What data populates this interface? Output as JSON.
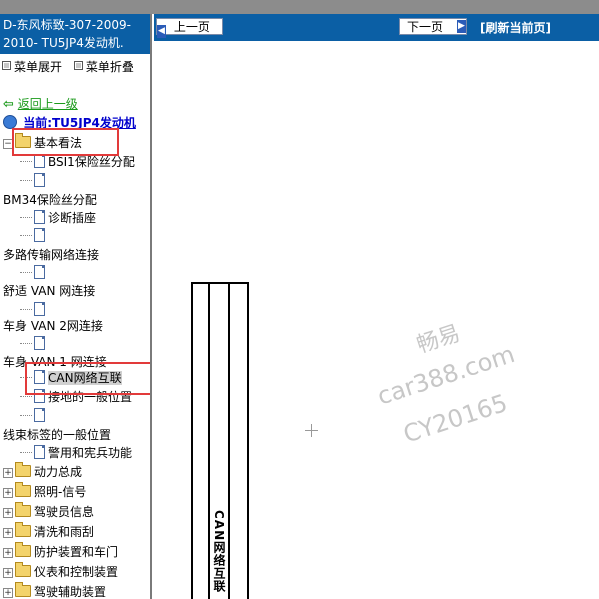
{
  "window": {
    "title_line1": "D-东风标致-307-2009-",
    "title_line2": "2010- TU5JP4发动机."
  },
  "menu": {
    "expand_label": "菜单展开",
    "collapse_label": "菜单折叠"
  },
  "navigation": {
    "back_label": "返回上一级",
    "current_label": "当前:TU5JP4发动机"
  },
  "tree": {
    "items": [
      {
        "label": "基本看法"
      },
      {
        "label": "BSI1保险丝分配"
      },
      {
        "label": ""
      },
      {
        "label": "BM34保险丝分配"
      },
      {
        "label": "诊断插座"
      },
      {
        "label": ""
      },
      {
        "label": "多路传输网络连接"
      },
      {
        "label": ""
      },
      {
        "label": "舒适 VAN 网连接"
      },
      {
        "label": ""
      },
      {
        "label": "车身 VAN 2网连接"
      },
      {
        "label": ""
      },
      {
        "label": "车身 VAN 1 网连接"
      },
      {
        "label": "CAN网络互联"
      },
      {
        "label": "接地的一般位置"
      },
      {
        "label": ""
      },
      {
        "label": "线束标签的一般位置"
      },
      {
        "label": "警用和宪兵功能"
      },
      {
        "label": "动力总成"
      },
      {
        "label": "照明-信号"
      },
      {
        "label": "驾驶员信息"
      },
      {
        "label": "清洗和雨刮"
      },
      {
        "label": "防护装置和车门"
      },
      {
        "label": "仪表和控制装置"
      },
      {
        "label": "驾驶辅助装置"
      }
    ]
  },
  "toolbar": {
    "prev_label": "上一页",
    "next_label": "下一页",
    "refresh_label": "[刷新当前页]"
  },
  "content": {
    "vertical_label": "CAN网络互联"
  },
  "watermark": {
    "line1": "畅易",
    "line2": "car388.com",
    "line3": "CY20165"
  },
  "colors": {
    "title_bar": "#0b5fa5",
    "highlight_box": "#e23a3a",
    "back_link": "#1a9a1a",
    "current_link": "#0000cc"
  }
}
